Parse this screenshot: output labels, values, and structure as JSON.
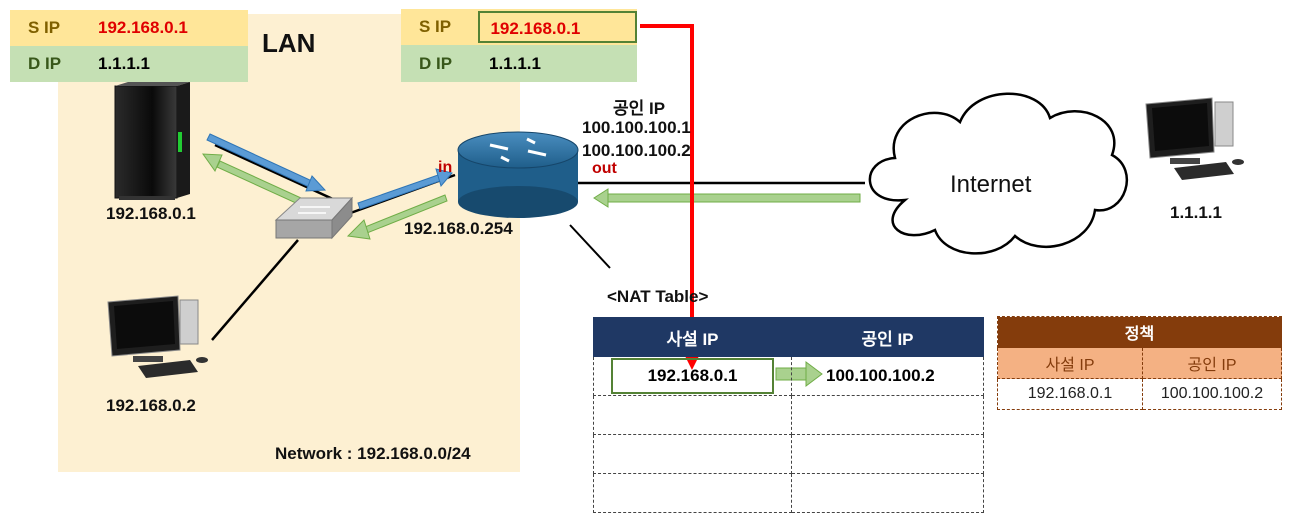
{
  "lan": {
    "title": "LAN",
    "network": "Network : 192.168.0.0/24"
  },
  "packet_left": {
    "s_label": "S IP",
    "s_value": "192.168.0.1",
    "d_label": "D IP",
    "d_value": "1.1.1.1"
  },
  "packet_right": {
    "s_label": "S IP",
    "s_value": "192.168.0.1",
    "d_label": "D IP",
    "d_value": "1.1.1.1"
  },
  "hosts": {
    "server_ip": "192.168.0.1",
    "pc_ip": "192.168.0.2",
    "remote_ip": "1.1.1.1"
  },
  "router": {
    "lan_ip": "192.168.0.254",
    "in_label": "in",
    "out_label": "out",
    "public_title": "공인 IP",
    "public_ip_1": "100.100.100.1",
    "public_ip_2": "100.100.100.2"
  },
  "internet": {
    "label": "Internet"
  },
  "nat_table": {
    "title": "<NAT Table>",
    "col_private": "사설 IP",
    "col_public": "공인 IP",
    "rows": [
      {
        "private": "192.168.0.1",
        "public": "100.100.100.2"
      }
    ]
  },
  "policy": {
    "title": "정책",
    "col_private": "사설 IP",
    "col_public": "공인 IP",
    "rows": [
      {
        "private": "192.168.0.1",
        "public": "100.100.100.2"
      }
    ]
  },
  "colors": {
    "lan_bg": "#fdf0d2",
    "sip_bg": "#ffe699",
    "dip_bg": "#c5e0b4",
    "nat_header": "#1f3864",
    "policy_header": "#843c0c",
    "policy_sub": "#f4b183",
    "flow_red": "#ff0000",
    "arrow_blue": "#5b9bd5",
    "arrow_green": "#a9d18e"
  }
}
